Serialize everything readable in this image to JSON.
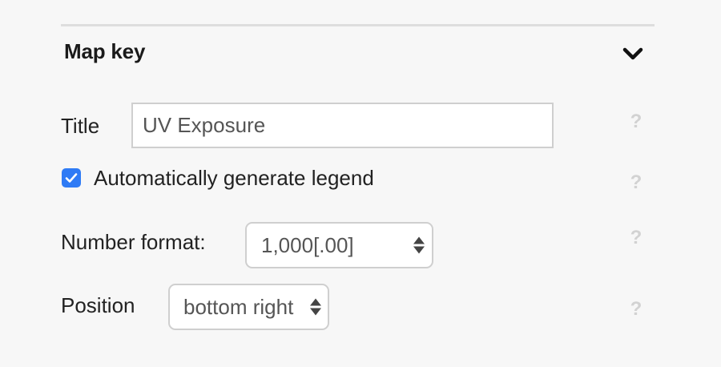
{
  "section": {
    "title": "Map key"
  },
  "fields": {
    "title": {
      "label": "Title",
      "value": "UV Exposure"
    },
    "legend": {
      "label": "Automatically generate legend",
      "checked": true
    },
    "number_format": {
      "label": "Number format:",
      "value": "1,000[.00]"
    },
    "position": {
      "label": "Position",
      "value": "bottom right"
    }
  },
  "help_glyph": "?",
  "colors": {
    "accent": "#2f7bf5",
    "help": "#d2d2d2",
    "background": "#f7f7f7"
  }
}
